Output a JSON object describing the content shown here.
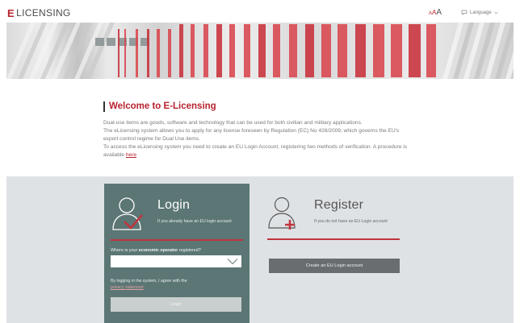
{
  "header": {
    "logo_letter": "E",
    "logo_text": "LICENSING",
    "font_size_control": {
      "small": "A",
      "medium": "A",
      "large": "A"
    },
    "language_label": "Language"
  },
  "welcome": {
    "title": "Welcome to E-Licensing",
    "paragraph_1": "Dual-use items are goods, software and technology that can be used for both civilian and military applications.",
    "paragraph_2": "The eLicensing system allows you to apply for any license foreseen by Regulation (EC) No 428/2009, which governs the EU's export control regime for Dual Use items.",
    "paragraph_3_prefix": "To access the eLicensing system you need to create an EU Login Account, registering two methods of verification. A procedure is available ",
    "paragraph_3_link": "here"
  },
  "login": {
    "title": "Login",
    "subtitle": "If you already have an EU login account",
    "question_prefix": "Where is your ",
    "question_bold": "economic operator",
    "question_suffix": " registered?",
    "select_value": "",
    "agree_text": "By logging in the system, I agree with the",
    "privacy_link": "privacy statement",
    "button_label": "Login"
  },
  "register": {
    "title": "Register",
    "subtitle": "If you do not have an EU Login account",
    "button_label": "Create an EU Login account"
  },
  "colors": {
    "brand_red": "#b8232f",
    "login_panel": "#5b7675",
    "grey_section": "#dfe2e5",
    "create_button": "#6a6d70"
  },
  "icons": {
    "chat": "chat-bubble-icon",
    "chevron": "chevron-down-icon",
    "login_user": "user-check-icon",
    "register_user": "user-plus-icon"
  }
}
